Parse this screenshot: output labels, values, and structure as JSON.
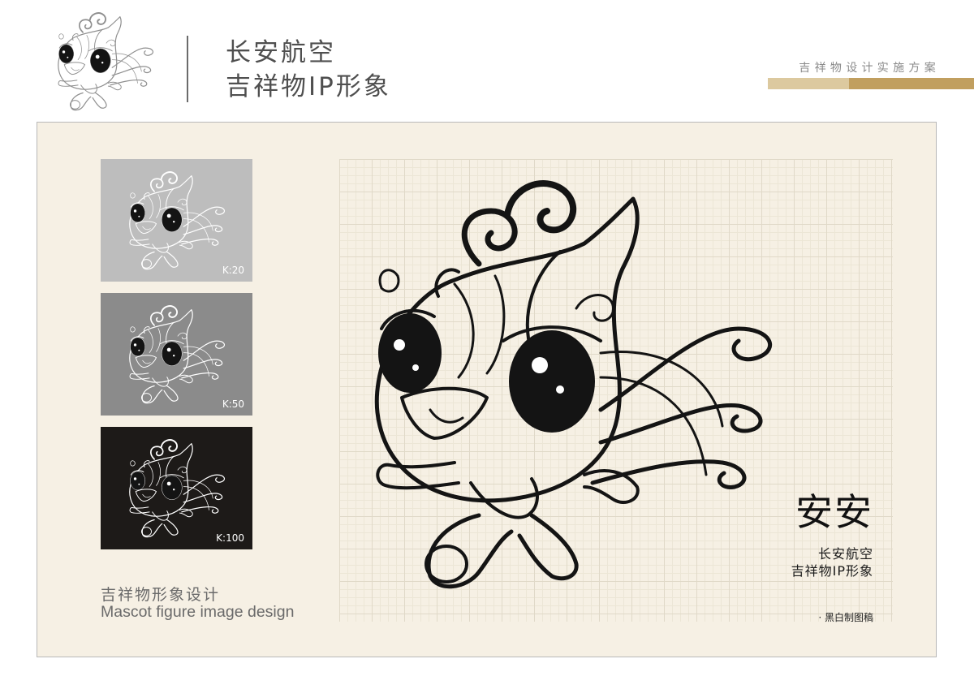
{
  "header": {
    "title_line1": "长安航空",
    "title_line2": "吉祥物IP形象",
    "subtitle": "吉祥物设计实施方案",
    "bar_colors": [
      "#dcc99f",
      "#c19f5f"
    ]
  },
  "panel": {
    "background": "#f6f0e4",
    "swatches": [
      {
        "label": "K:20",
        "color": "#bdbdbd"
      },
      {
        "label": "K:50",
        "color": "#8b8b8b"
      },
      {
        "label": "K:100",
        "color": "#1d1a18"
      }
    ],
    "caption_cn": "吉祥物形象设计",
    "caption_en": "Mascot figure image design"
  },
  "mascot": {
    "name": "安安",
    "sub_line1": "长安航空",
    "sub_line2": "吉祥物IP形象",
    "draft_note": "· 黑白制图稿"
  }
}
